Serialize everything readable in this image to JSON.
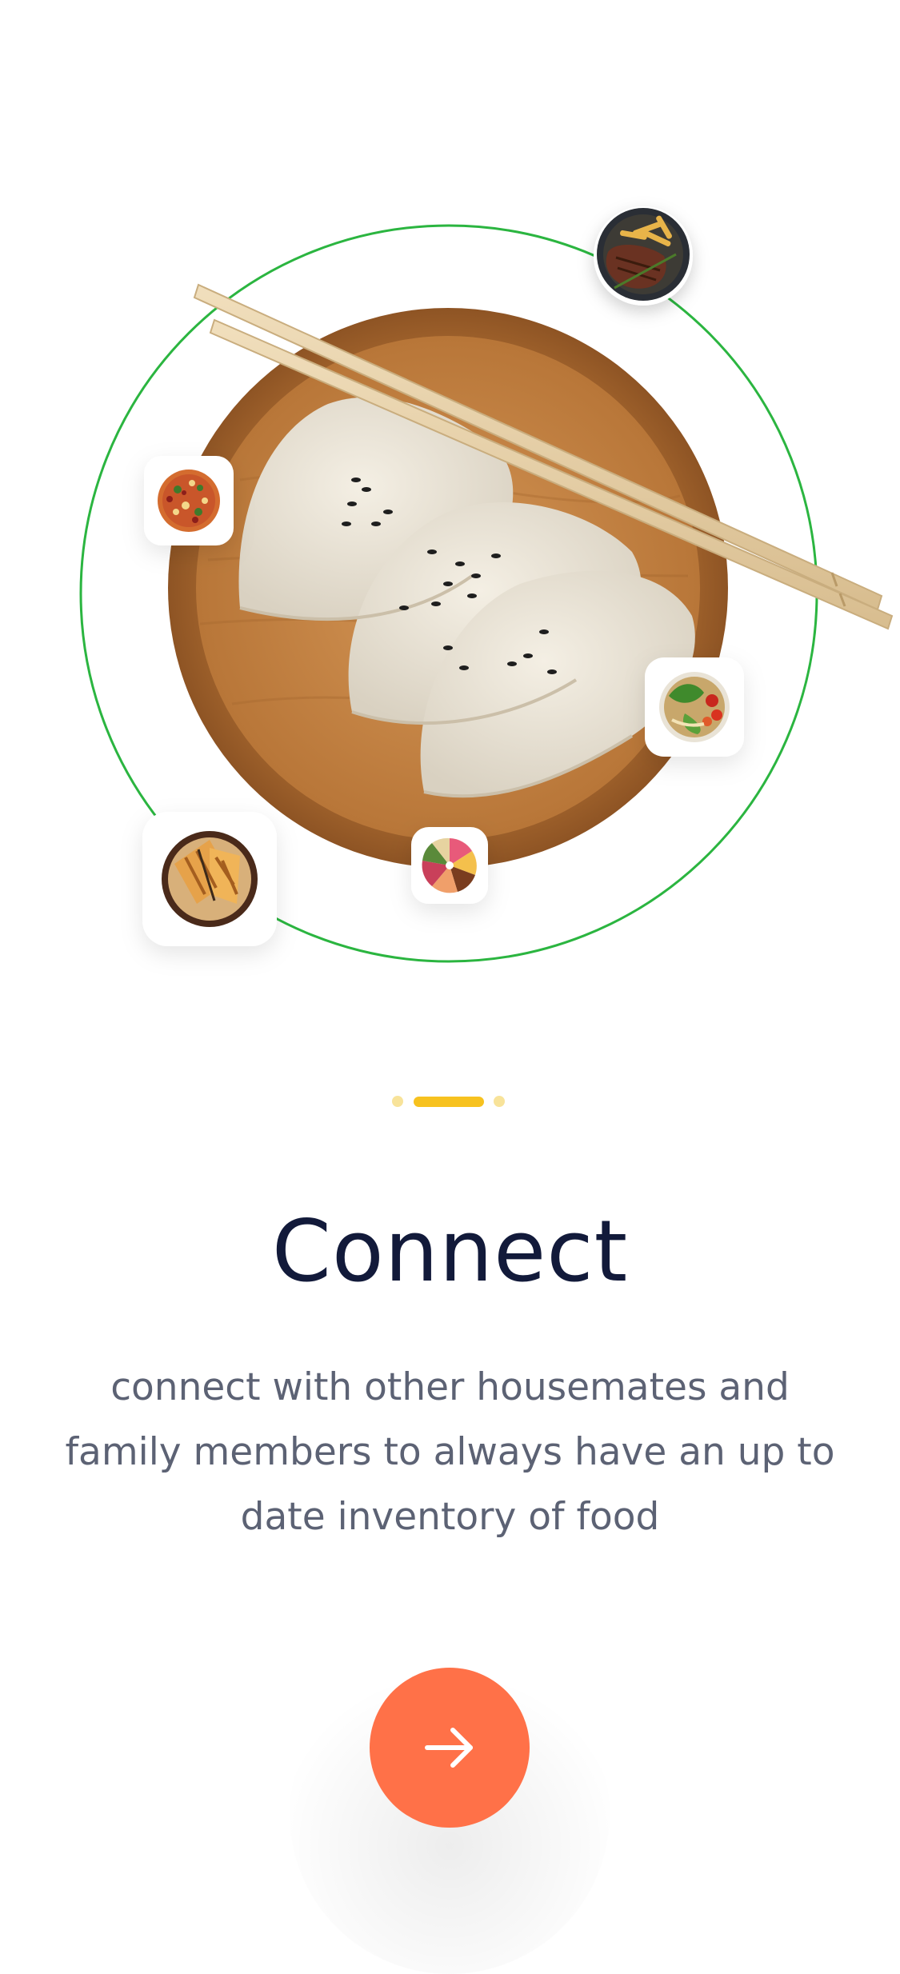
{
  "onboarding": {
    "title": "Connect",
    "description": "connect with other housemates and family members to always have an up to date inventory of food",
    "pager": {
      "total": 3,
      "current": 2
    },
    "next_icon": "arrow-right-icon"
  },
  "hero": {
    "main_dish": "dumplings-on-wooden-plate",
    "orbit_items": [
      "steak-and-fries-icon",
      "pizza-icon",
      "salad-bowl-icon",
      "cake-icon",
      "grilled-sandwich-icon"
    ]
  },
  "colors": {
    "ring": "#2bb540",
    "accent": "#ff7148",
    "pager_active": "#f7c21f",
    "pager_inactive": "#f8e39a",
    "title": "#121a3a",
    "text": "#5c6274"
  }
}
